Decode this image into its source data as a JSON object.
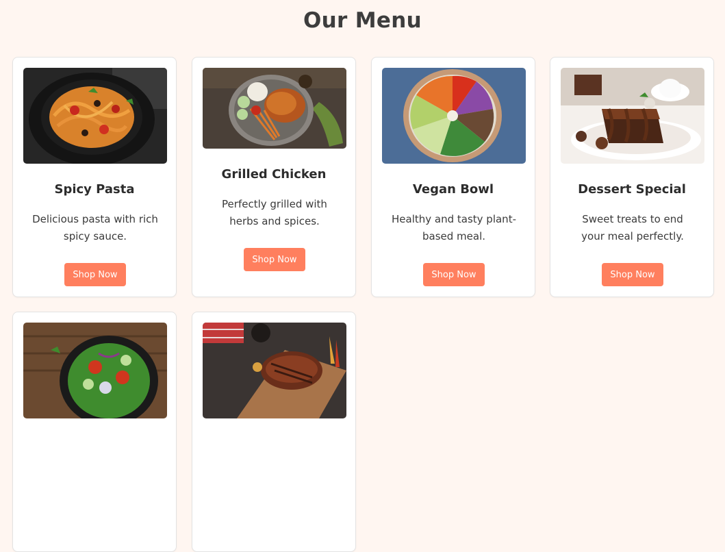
{
  "page": {
    "title": "Our Menu"
  },
  "colors": {
    "background": "#fff6f1",
    "accent": "#ff7f5e",
    "card": "#ffffff"
  },
  "menu": {
    "items": [
      {
        "name": "Spicy Pasta",
        "description": "Delicious pasta with rich spicy sauce.",
        "button_label": "Shop Now",
        "image": "spicy-pasta-photo"
      },
      {
        "name": "Grilled Chicken",
        "description": "Perfectly grilled with herbs and spices.",
        "button_label": "Shop Now",
        "image": "grilled-chicken-photo"
      },
      {
        "name": "Vegan Bowl",
        "description": "Healthy and tasty plant-based meal.",
        "button_label": "Shop Now",
        "image": "vegan-bowl-photo"
      },
      {
        "name": "Dessert Special",
        "description": "Sweet treats to end your meal perfectly.",
        "button_label": "Shop Now",
        "image": "dessert-photo"
      },
      {
        "image": "salad-photo"
      },
      {
        "image": "steak-photo"
      }
    ]
  }
}
